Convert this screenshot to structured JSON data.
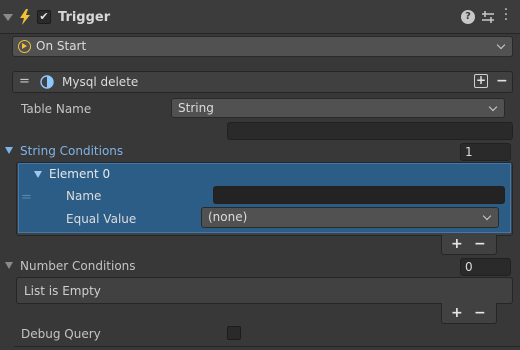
{
  "header": {
    "title": "Trigger",
    "enabled": true,
    "help_icon": "help-icon",
    "settings_icon": "presets-icon",
    "menu_icon": "kebab-menu-icon"
  },
  "event_dropdown": {
    "value": "On Start",
    "icon": "play-circle-icon"
  },
  "node": {
    "drag_handle": "=",
    "title": "Mysql delete",
    "icon": "half-circle-icon",
    "add_label": "+",
    "remove_label": "−"
  },
  "table_name": {
    "label": "Table Name",
    "type_value": "String",
    "value": ""
  },
  "string_conditions": {
    "label": "String Conditions",
    "count": "1",
    "elements": [
      {
        "label": "Element 0",
        "name_label": "Name",
        "name_value": "",
        "equal_label": "Equal Value",
        "equal_value": "(none)",
        "handle": "="
      }
    ],
    "add_label": "+",
    "remove_label": "−"
  },
  "number_conditions": {
    "label": "Number Conditions",
    "count": "0",
    "empty_text": "List is Empty",
    "add_label": "+",
    "remove_label": "−"
  },
  "debug_query": {
    "label": "Debug Query",
    "checked": false
  },
  "colors": {
    "background": "#383838",
    "selected_element": "#2c5d87",
    "accent_label": "#7fb4ea",
    "trigger_icon": "#f2c037"
  }
}
